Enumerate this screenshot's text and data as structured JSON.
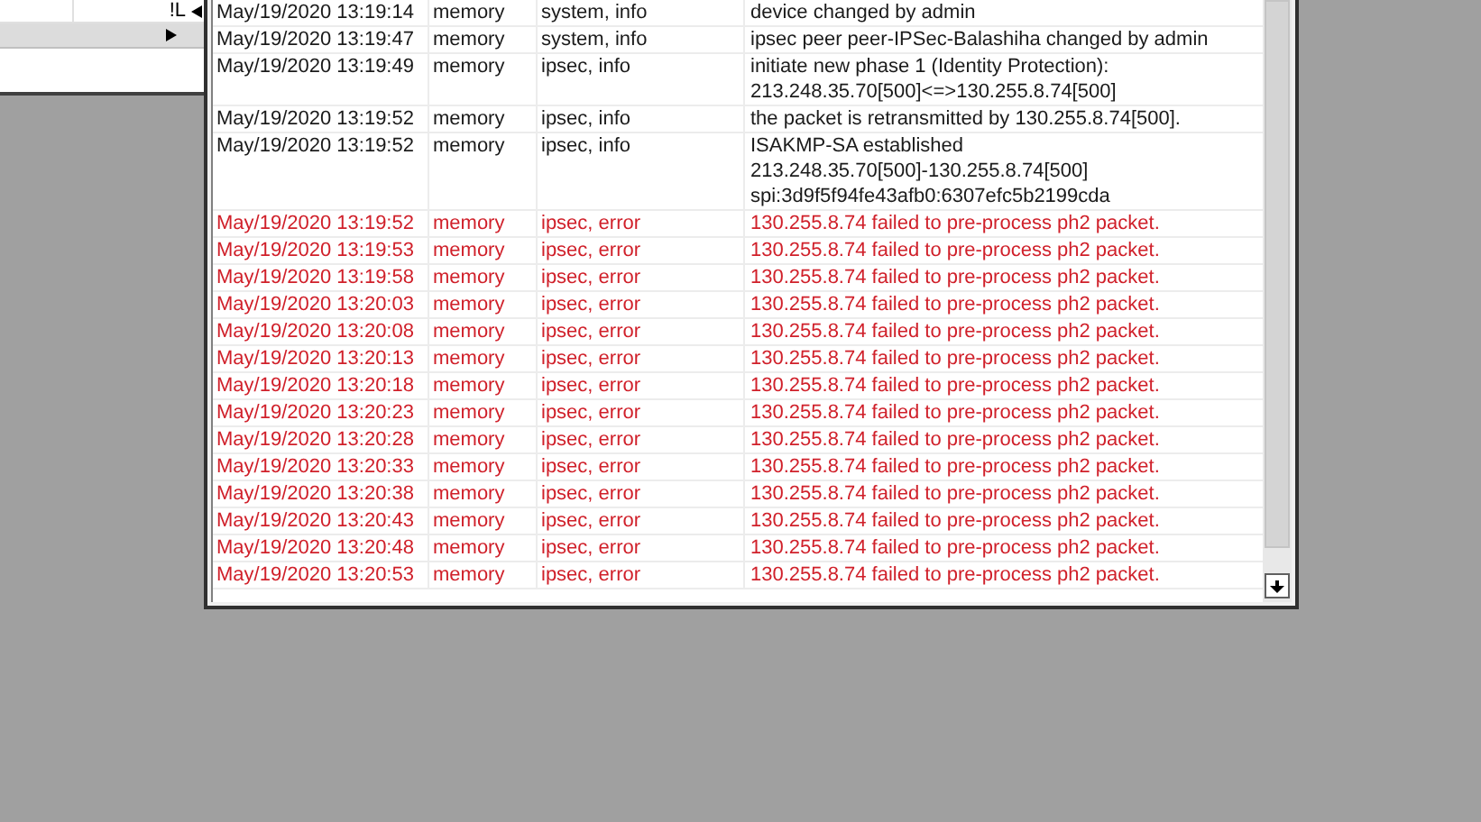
{
  "side_panel": {
    "cell_text": "!L"
  },
  "log": {
    "rows": [
      {
        "kind": "info",
        "time": "May/19/2020 13:19:14",
        "buffer": "memory",
        "topics": "system, info",
        "message_lines": [
          "device changed by admin"
        ]
      },
      {
        "kind": "info",
        "time": "May/19/2020 13:19:47",
        "buffer": "memory",
        "topics": "system, info",
        "message_lines": [
          "ipsec peer peer-IPSec-Balashiha changed by admin"
        ]
      },
      {
        "kind": "info",
        "time": "May/19/2020 13:19:49",
        "buffer": "memory",
        "topics": "ipsec, info",
        "message_lines": [
          "initiate new phase 1 (Identity Protection):",
          "213.248.35.70[500]<=>130.255.8.74[500]"
        ]
      },
      {
        "kind": "info",
        "time": "May/19/2020 13:19:52",
        "buffer": "memory",
        "topics": "ipsec, info",
        "message_lines": [
          "the packet is retransmitted by 130.255.8.74[500]."
        ]
      },
      {
        "kind": "info",
        "time": "May/19/2020 13:19:52",
        "buffer": "memory",
        "topics": "ipsec, info",
        "message_lines": [
          "ISAKMP-SA established",
          "213.248.35.70[500]-130.255.8.74[500]",
          "spi:3d9f5f94fe43afb0:6307efc5b2199cda"
        ]
      },
      {
        "kind": "error",
        "time": "May/19/2020 13:19:52",
        "buffer": "memory",
        "topics": "ipsec, error",
        "message_lines": [
          "130.255.8.74 failed to pre-process ph2 packet."
        ]
      },
      {
        "kind": "error",
        "time": "May/19/2020 13:19:53",
        "buffer": "memory",
        "topics": "ipsec, error",
        "message_lines": [
          "130.255.8.74 failed to pre-process ph2 packet."
        ]
      },
      {
        "kind": "error",
        "time": "May/19/2020 13:19:58",
        "buffer": "memory",
        "topics": "ipsec, error",
        "message_lines": [
          "130.255.8.74 failed to pre-process ph2 packet."
        ]
      },
      {
        "kind": "error",
        "time": "May/19/2020 13:20:03",
        "buffer": "memory",
        "topics": "ipsec, error",
        "message_lines": [
          "130.255.8.74 failed to pre-process ph2 packet."
        ]
      },
      {
        "kind": "error",
        "time": "May/19/2020 13:20:08",
        "buffer": "memory",
        "topics": "ipsec, error",
        "message_lines": [
          "130.255.8.74 failed to pre-process ph2 packet."
        ]
      },
      {
        "kind": "error",
        "time": "May/19/2020 13:20:13",
        "buffer": "memory",
        "topics": "ipsec, error",
        "message_lines": [
          "130.255.8.74 failed to pre-process ph2 packet."
        ]
      },
      {
        "kind": "error",
        "time": "May/19/2020 13:20:18",
        "buffer": "memory",
        "topics": "ipsec, error",
        "message_lines": [
          "130.255.8.74 failed to pre-process ph2 packet."
        ]
      },
      {
        "kind": "error",
        "time": "May/19/2020 13:20:23",
        "buffer": "memory",
        "topics": "ipsec, error",
        "message_lines": [
          "130.255.8.74 failed to pre-process ph2 packet."
        ]
      },
      {
        "kind": "error",
        "time": "May/19/2020 13:20:28",
        "buffer": "memory",
        "topics": "ipsec, error",
        "message_lines": [
          "130.255.8.74 failed to pre-process ph2 packet."
        ]
      },
      {
        "kind": "error",
        "time": "May/19/2020 13:20:33",
        "buffer": "memory",
        "topics": "ipsec, error",
        "message_lines": [
          "130.255.8.74 failed to pre-process ph2 packet."
        ]
      },
      {
        "kind": "error",
        "time": "May/19/2020 13:20:38",
        "buffer": "memory",
        "topics": "ipsec, error",
        "message_lines": [
          "130.255.8.74 failed to pre-process ph2 packet."
        ]
      },
      {
        "kind": "error",
        "time": "May/19/2020 13:20:43",
        "buffer": "memory",
        "topics": "ipsec, error",
        "message_lines": [
          "130.255.8.74 failed to pre-process ph2 packet."
        ]
      },
      {
        "kind": "error",
        "time": "May/19/2020 13:20:48",
        "buffer": "memory",
        "topics": "ipsec, error",
        "message_lines": [
          "130.255.8.74 failed to pre-process ph2 packet."
        ]
      },
      {
        "kind": "error",
        "time": "May/19/2020 13:20:53",
        "buffer": "memory",
        "topics": "ipsec, error",
        "message_lines": [
          "130.255.8.74 failed to pre-process ph2 packet."
        ]
      }
    ]
  }
}
